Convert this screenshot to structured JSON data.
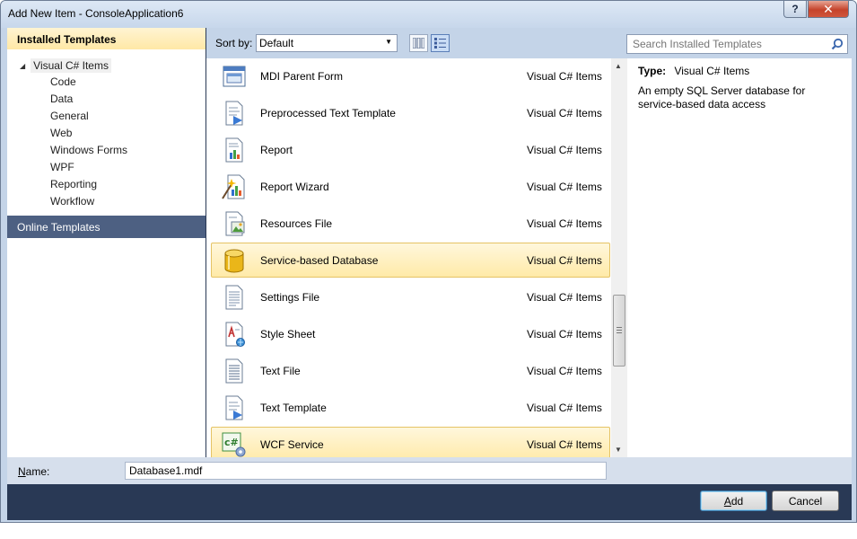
{
  "window": {
    "title": "Add New Item - ConsoleApplication6",
    "help_label": "?",
    "close_label": "✕"
  },
  "left": {
    "installed_header": "Installed Templates",
    "tree_root": "Visual C# Items",
    "children": [
      "Code",
      "Data",
      "General",
      "Web",
      "Windows Forms",
      "WPF",
      "Reporting",
      "Workflow"
    ],
    "online_header": "Online Templates"
  },
  "toolbar": {
    "sort_label": "Sort by:",
    "sort_value": "Default"
  },
  "search": {
    "placeholder": "Search Installed Templates"
  },
  "items": [
    {
      "name": "MDI Parent Form",
      "category": "Visual C# Items",
      "icon": "mdi-form-icon"
    },
    {
      "name": "Preprocessed Text Template",
      "category": "Visual C# Items",
      "icon": "text-template-icon"
    },
    {
      "name": "Report",
      "category": "Visual C# Items",
      "icon": "report-icon"
    },
    {
      "name": "Report Wizard",
      "category": "Visual C# Items",
      "icon": "report-wizard-icon"
    },
    {
      "name": "Resources File",
      "category": "Visual C# Items",
      "icon": "resources-file-icon"
    },
    {
      "name": "Service-based Database",
      "category": "Visual C# Items",
      "icon": "database-icon",
      "selected": true
    },
    {
      "name": "Settings File",
      "category": "Visual C# Items",
      "icon": "settings-file-icon"
    },
    {
      "name": "Style Sheet",
      "category": "Visual C# Items",
      "icon": "style-sheet-icon"
    },
    {
      "name": "Text File",
      "category": "Visual C# Items",
      "icon": "text-file-icon"
    },
    {
      "name": "Text Template",
      "category": "Visual C# Items",
      "icon": "text-template-icon"
    },
    {
      "name": "WCF Service",
      "category": "Visual C# Items",
      "icon": "wcf-service-icon",
      "hovered": true
    }
  ],
  "description": {
    "type_label": "Type:",
    "type_value": "Visual C# Items",
    "text": "An empty SQL Server database for service-based data access"
  },
  "name_field": {
    "label": "Name:",
    "label_rest": "ame:",
    "label_mnemonic": "N",
    "value": "Database1.mdf"
  },
  "buttons": {
    "add": "Add",
    "add_rest": "dd",
    "add_mnemonic": "A",
    "cancel": "Cancel"
  },
  "colors": {
    "selection": "#ffeaa8",
    "online_header": "#4d6082",
    "window_frame": "#c4d4e8"
  }
}
